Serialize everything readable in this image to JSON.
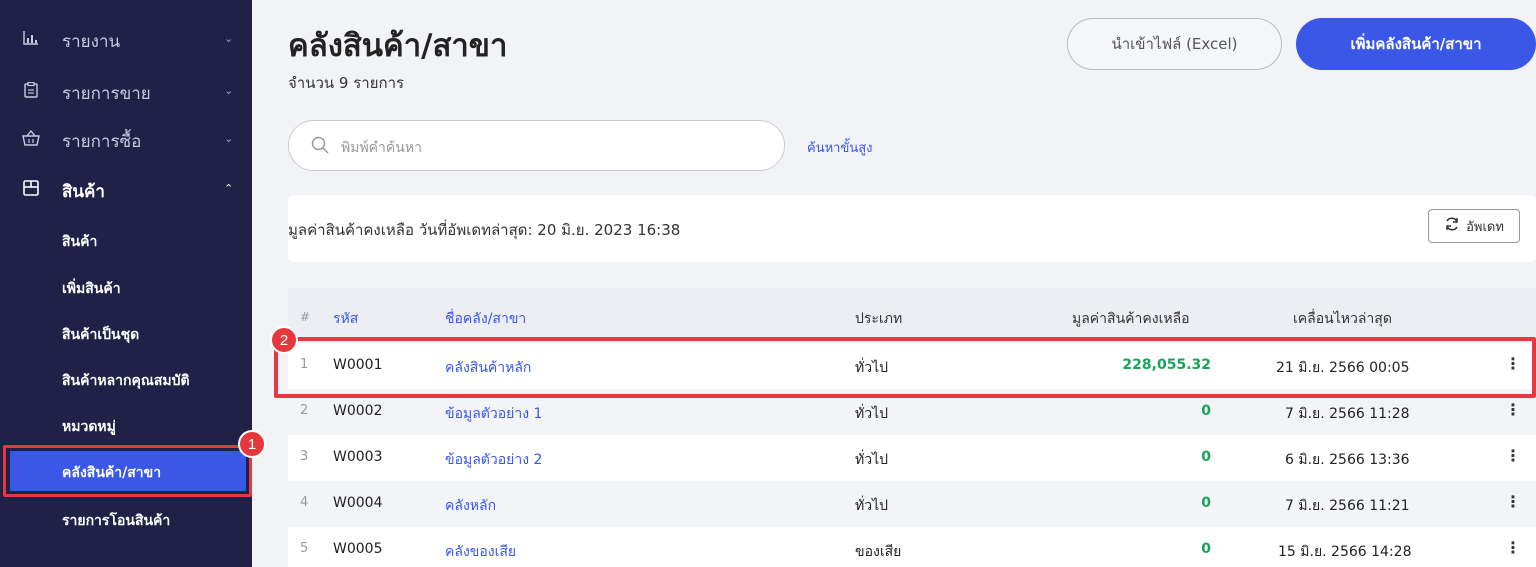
{
  "sidebar": {
    "items": [
      {
        "label": "รายงาน",
        "icon": "chart-icon"
      },
      {
        "label": "รายการขาย",
        "icon": "clipboard-icon"
      },
      {
        "label": "รายการซื้อ",
        "icon": "basket-icon"
      },
      {
        "label": "สินค้า",
        "icon": "box-icon"
      }
    ],
    "sub_items": [
      {
        "label": "สินค้า"
      },
      {
        "label": "เพิ่มสินค้า"
      },
      {
        "label": "สินค้าเป็นชุด"
      },
      {
        "label": "สินค้าหลากคุณสมบัติ"
      },
      {
        "label": "หมวดหมู่"
      },
      {
        "label": "คลังสินค้า/สาขา"
      },
      {
        "label": "รายการโอนสินค้า"
      }
    ]
  },
  "annotations": {
    "badge1": "1",
    "badge2": "2"
  },
  "header": {
    "title": "คลังสินค้า/สาขา",
    "count": "จำนวน 9 รายการ",
    "import_button": "นำเข้าไฟล์ (Excel)",
    "add_button": "เพิ่มคลังสินค้า/สาขา"
  },
  "search": {
    "placeholder": "พิมพ์คำค้นหา",
    "advanced": "ค้นหาขั้นสูง"
  },
  "value_card": {
    "text": "มูลค่าสินค้าคงเหลือ วันที่อัพเดทล่าสุด: 20 มิ.ย. 2023 16:38",
    "update_button": "อัพเดท"
  },
  "table": {
    "headers": {
      "hash": "#",
      "code": "รหัส",
      "name": "ชื่อคลัง/สาขา",
      "type": "ประเภท",
      "value": "มูลค่าสินค้าคงเหลือ",
      "last_move": "เคลื่อนไหวล่าสุด"
    },
    "rows": [
      {
        "num": "1",
        "code": "W0001",
        "name": "คลังสินค้าหลัก",
        "type": "ทั่วไป",
        "value": "228,055.32",
        "last_move": "21 มิ.ย. 2566 00:05"
      },
      {
        "num": "2",
        "code": "W0002",
        "name": "ข้อมูลตัวอย่าง 1",
        "type": "ทั่วไป",
        "value": "0",
        "last_move": "7 มิ.ย. 2566 11:28"
      },
      {
        "num": "3",
        "code": "W0003",
        "name": "ข้อมูลตัวอย่าง 2",
        "type": "ทั่วไป",
        "value": "0",
        "last_move": "6 มิ.ย. 2566 13:36"
      },
      {
        "num": "4",
        "code": "W0004",
        "name": "คลังหลัก",
        "type": "ทั่วไป",
        "value": "0",
        "last_move": "7 มิ.ย. 2566 11:21"
      },
      {
        "num": "5",
        "code": "W0005",
        "name": "คลังของเสีย",
        "type": "ของเสีย",
        "value": "0",
        "last_move": "15 มิ.ย. 2566 14:28"
      }
    ]
  },
  "colors": {
    "accent": "#3a57e8",
    "sidebar_bg": "#1f2147",
    "highlight": "#e5393f",
    "value_green": "#1aa35a"
  }
}
